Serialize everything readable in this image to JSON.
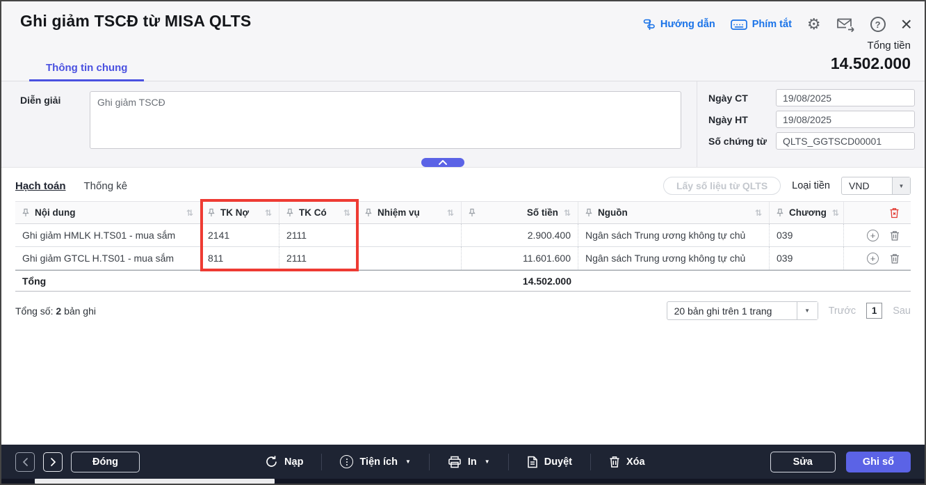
{
  "window": {
    "title": "Ghi giảm TSCĐ từ MISA QLTS"
  },
  "header": {
    "guide_label": "Hướng dẫn",
    "shortcuts_label": "Phím tắt",
    "total_label": "Tổng tiền",
    "total_value": "14.502.000"
  },
  "tabs": {
    "general": "Thông tin chung"
  },
  "form": {
    "description_label": "Diễn giải",
    "description_value": "Ghi giảm TSCĐ",
    "doc_date_label": "Ngày CT",
    "doc_date_value": "19/08/2025",
    "post_date_label": "Ngày HT",
    "post_date_value": "19/08/2025",
    "doc_no_label": "Số chứng từ",
    "doc_no_value": "QLTS_GGTSCD00001"
  },
  "detail": {
    "tab_accounting": "Hạch toán",
    "tab_statistics": "Thống kê",
    "fetch_button": "Lấy số liệu từ QLTS",
    "currency_label": "Loại tiền",
    "currency_value": "VND"
  },
  "table": {
    "headers": {
      "content": "Nội dung",
      "debit": "TK Nợ",
      "credit": "TK Có",
      "task": "Nhiệm vụ",
      "amount": "Số tiền",
      "source": "Nguồn",
      "chapter": "Chương"
    },
    "rows": [
      {
        "content": "Ghi giảm HMLK H.TS01 - mua sắm",
        "debit": "2141",
        "credit": "2111",
        "task": "",
        "amount": "2.900.400",
        "source": "Ngân sách Trung ương không tự chủ",
        "chapter": "039"
      },
      {
        "content": "Ghi giảm GTCL H.TS01 - mua sắm",
        "debit": "811",
        "credit": "2111",
        "task": "",
        "amount": "11.601.600",
        "source": "Ngân sách Trung ương không tự chủ",
        "chapter": "039"
      }
    ],
    "total_label": "Tổng",
    "total_value": "14.502.000"
  },
  "pagination": {
    "summary_prefix": "Tổng số:",
    "summary_count": "2",
    "summary_suffix": "bản ghi",
    "page_size": "20 bản ghi trên 1 trang",
    "prev": "Trước",
    "page": "1",
    "next": "Sau"
  },
  "toolbar": {
    "close": "Đóng",
    "reload": "Nạp",
    "utilities": "Tiện ích",
    "print": "In",
    "approve": "Duyệt",
    "delete": "Xóa",
    "edit": "Sửa",
    "save": "Ghi sổ"
  },
  "icons": {
    "gear": "⚙",
    "help": "?",
    "close": "×",
    "sort": "⇅",
    "caret_down": "▼",
    "plus": "+"
  },
  "colors": {
    "accent": "#4a51e0",
    "link_blue": "#1a73e8",
    "highlight_red": "#ee3b33",
    "toolbar_bg": "#1e2433",
    "save_button": "#5b63e6"
  }
}
